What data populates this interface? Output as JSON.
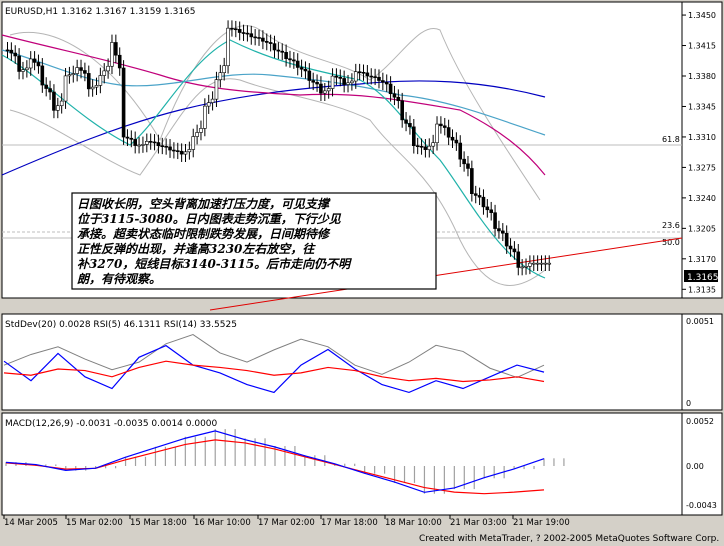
{
  "window": {
    "symbol_header": "EURUSD,H1  1.3162 1.3167 1.3159 1.3165",
    "footer": "Created with MetaTrader, ? 2002-2005 MetaQuotes Software Corp."
  },
  "chart_data": [
    {
      "type": "candlestick",
      "title": "EURUSD,H1  1.3162 1.3167 1.3159 1.3165",
      "ylim": [
        1.3125,
        1.3465
      ],
      "y_ticks": [
        "1.3450",
        "1.3415",
        "1.3380",
        "1.3345",
        "1.3310",
        "1.3275",
        "1.3240",
        "1.3205",
        "1.3170",
        "1.3135"
      ],
      "current_price_label": "1.3165",
      "current_price": 1.3165,
      "fib_levels": [
        {
          "label": "61.8",
          "price": 1.331
        },
        {
          "label": "23.6",
          "price": 1.3218
        },
        {
          "label": "50.0",
          "price": 1.3202
        }
      ],
      "close_path": [
        1.341,
        1.3385,
        1.34,
        1.337,
        1.334,
        1.338,
        1.339,
        1.3365,
        1.338,
        1.342,
        1.331,
        1.33,
        1.3305,
        1.33,
        1.3295,
        1.329,
        1.331,
        1.3345,
        1.3375,
        1.3435,
        1.343,
        1.3425,
        1.342,
        1.341,
        1.34,
        1.339,
        1.3375,
        1.336,
        1.338,
        1.337,
        1.3385,
        1.338,
        1.3375,
        1.336,
        1.333,
        1.33,
        1.3295,
        1.3325,
        1.331,
        1.3285,
        1.3245,
        1.323,
        1.3205,
        1.3185,
        1.316,
        1.3165,
        1.3165
      ],
      "annotation": "日图收长阴，空头背离加速打压力度，可见支撑位于3115-3080。日内图表走势沉重，下行少见承接。超卖状态临时限制跌势发展，日间期待修正性反弹的出现，并逢高3230左右放空，往补3270，短线目标3140-3115。后市走向仍不明朗，有待观察。",
      "annotation_lines": [
        "日图收长阴，空头背离加速打压力度，可见支撑",
        "位于3115-3080。日内图表走势沉重，下行少见",
        "承接。超卖状态临时限制跌势发展，日间期待修",
        "正性反弹的出现，并逢高3230左右放空，往",
        "补3270，短线目标3140-3115。后市走向仍不明",
        "朗，有待观察。"
      ]
    },
    {
      "type": "line",
      "title": "StdDev(20) 0.0028  RSI(5) 46.1311  RSI(14) 33.5525",
      "y_ticks": [
        "0.0051",
        "0"
      ],
      "series": [
        {
          "name": "StdDev(20)",
          "color": "#808080",
          "values": [
            0.0028,
            0.0035,
            0.004,
            0.0032,
            0.0025,
            0.003,
            0.0042,
            0.0048,
            0.0036,
            0.003,
            0.0038,
            0.0045,
            0.004,
            0.0028,
            0.0022,
            0.003,
            0.0041,
            0.0037,
            0.0026,
            0.002,
            0.0028
          ]
        },
        {
          "name": "RSI(5)",
          "color": "#0000ff",
          "values": [
            60,
            35,
            70,
            40,
            25,
            65,
            80,
            55,
            45,
            30,
            20,
            55,
            75,
            50,
            30,
            20,
            35,
            25,
            40,
            55,
            46
          ]
        },
        {
          "name": "RSI(14)",
          "color": "#ff0000",
          "values": [
            45,
            42,
            50,
            48,
            40,
            52,
            60,
            55,
            52,
            48,
            42,
            45,
            52,
            48,
            40,
            35,
            38,
            34,
            36,
            40,
            34
          ]
        }
      ]
    },
    {
      "type": "bar",
      "title": "MACD(12,26,9) -0.0031 -0.0035 0.0014 0.0000",
      "y_ticks": [
        "0.0052",
        "0.00",
        "-0.0043"
      ],
      "x_ticks": [
        "14 Mar 2005",
        "15 Mar 02:00",
        "15 Mar 18:00",
        "16 Mar 10:00",
        "17 Mar 02:00",
        "17 Mar 18:00",
        "18 Mar 10:00",
        "21 Mar 03:00",
        "21 Mar 19:00"
      ],
      "macd_hist": [
        0.0005,
        0.0002,
        -0.0006,
        -0.0003,
        0.0012,
        0.0025,
        0.0038,
        0.0048,
        0.0036,
        0.0026,
        0.0014,
        0.0003,
        -0.001,
        -0.0022,
        -0.0036,
        -0.003,
        -0.0016,
        -0.0004,
        0.001
      ],
      "signal": [
        0.0004,
        0.0001,
        -0.0004,
        -0.0003,
        0.0008,
        0.0018,
        0.0028,
        0.0034,
        0.003,
        0.0022,
        0.0012,
        0.0002,
        -0.0008,
        -0.0018,
        -0.0028,
        -0.0034,
        -0.0036,
        -0.0034,
        -0.0031
      ]
    }
  ]
}
